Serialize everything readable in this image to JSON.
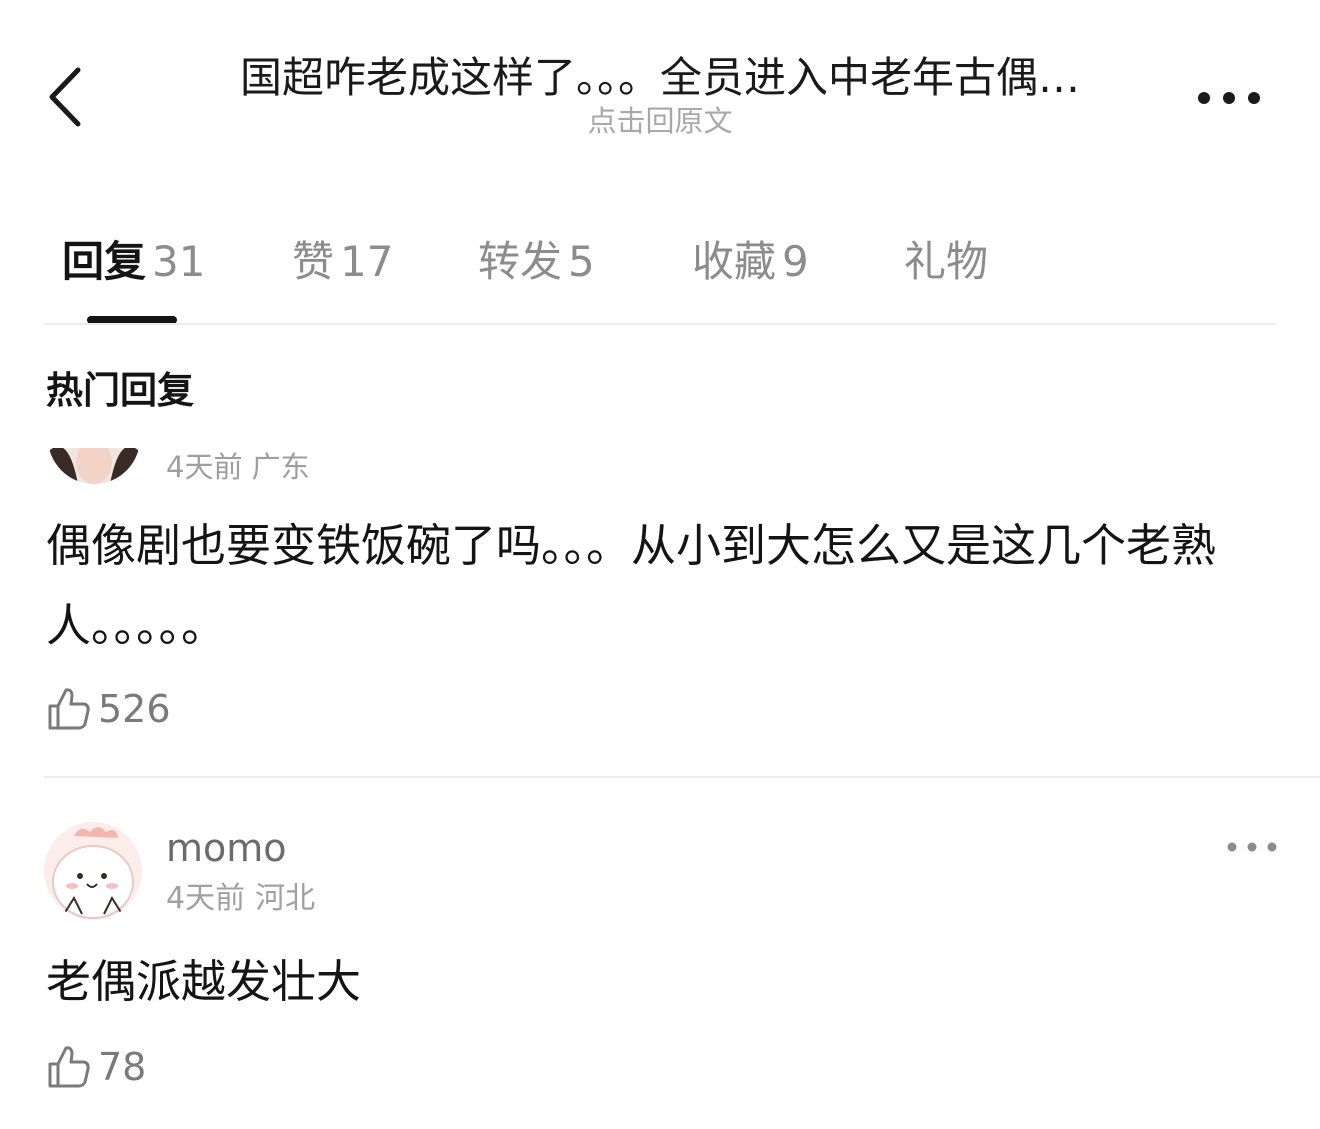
{
  "header": {
    "title": "国超咋老成这样了。。。全员进入中老年古偶…",
    "subtitle": "点击回原文",
    "back_icon": "chevron-left-icon",
    "more_icon": "ellipsis-horizontal-icon"
  },
  "tabs": [
    {
      "label": "回复",
      "count": "31",
      "active": true
    },
    {
      "label": "赞",
      "count": "17",
      "active": false
    },
    {
      "label": "转发",
      "count": "5",
      "active": false
    },
    {
      "label": "收藏",
      "count": "9",
      "active": false
    },
    {
      "label": "礼物",
      "count": "",
      "active": false
    }
  ],
  "section_title": "热门回复",
  "comments": [
    {
      "meta_partial": "4天前 广东",
      "text": "偶像剧也要变铁饭碗了吗。。。从小到大怎么又是这几个老熟人。。。。。",
      "likes": "526"
    },
    {
      "username": "momo",
      "time": "4天前",
      "location": "河北",
      "text": "老偶派越发壮大",
      "likes": "78"
    }
  ],
  "colors": {
    "text_primary": "#141414",
    "text_secondary": "#8c8c8c",
    "divider": "#ededed"
  }
}
